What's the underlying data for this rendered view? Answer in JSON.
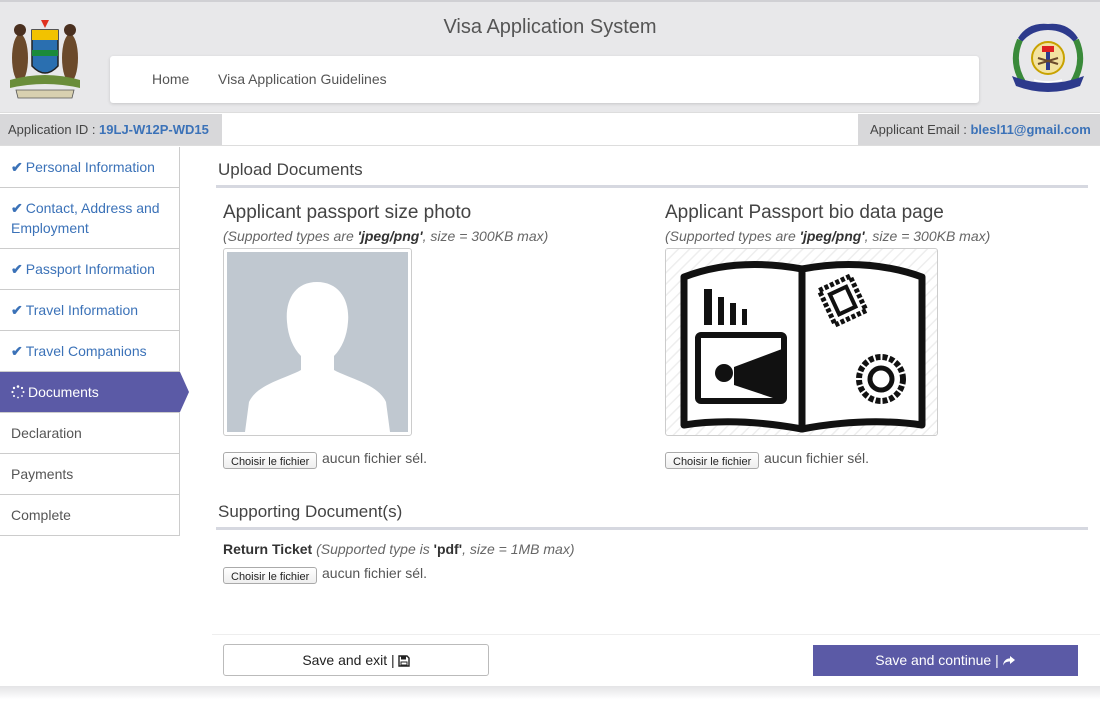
{
  "header": {
    "title": "Visa Application System",
    "nav": [
      "Home",
      "Visa Application Guidelines"
    ]
  },
  "info": {
    "id_label": "Application ID : ",
    "id_value": "19LJ-W12P-WD15",
    "email_label": "Applicant Email : ",
    "email_value": "blesl11@gmail.com"
  },
  "sidebar": {
    "items": [
      {
        "label": "Personal Information"
      },
      {
        "label": "Contact, Address and Employment"
      },
      {
        "label": "Passport Information"
      },
      {
        "label": "Travel Information"
      },
      {
        "label": "Travel Companions"
      },
      {
        "label": "Documents"
      },
      {
        "label": "Declaration"
      },
      {
        "label": "Payments"
      },
      {
        "label": "Complete"
      }
    ]
  },
  "upload": {
    "title": "Upload Documents",
    "photo_label": "Applicant passport size photo",
    "photo_hint": "(Supported types are 'jpeg/png', size = 300KB max)",
    "bio_label": "Applicant Passport bio data page",
    "bio_hint": "(Supported types are 'jpeg/png', size = 300KB max)",
    "file_button": "Choisir le fichier",
    "no_file": "aucun fichier sél."
  },
  "supporting": {
    "title": "Supporting Document(s)",
    "ticket_label": "Return Ticket",
    "ticket_hint": "(Supported type is 'pdf', size = 1MB max)"
  },
  "actions": {
    "save_exit": "Save and exit |",
    "save_continue": "Save and continue |"
  },
  "colors": {
    "accent": "#5b5aa6",
    "link": "#3b72b8"
  }
}
